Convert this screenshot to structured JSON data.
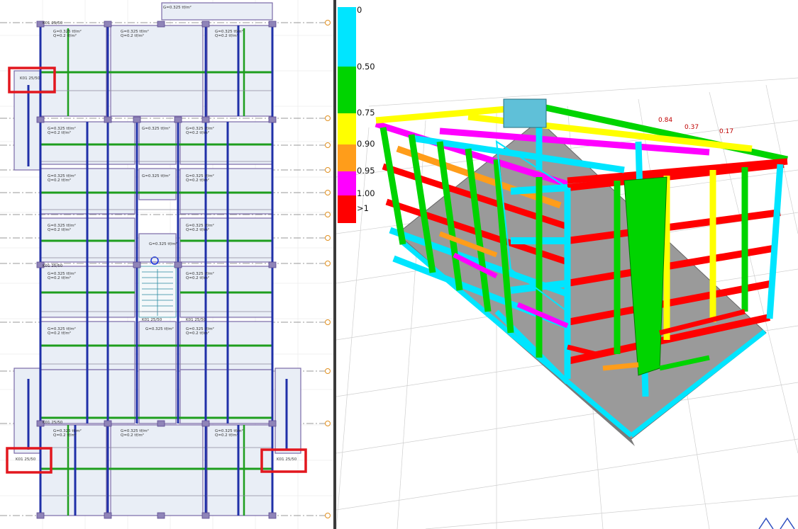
{
  "plan": {
    "load_text_g": "G=0.325 tf/m²",
    "load_text_q": "Q=0.2 tf/m²",
    "beam_label": "K01 25/50",
    "top_beam_label": "K01 25/50"
  },
  "legend": {
    "labels": [
      "0",
      "0.50",
      "0.75",
      "0.90",
      "0.95",
      "1.00",
      ">1"
    ],
    "colors": {
      "cyan": "#00e5ff",
      "green": "#00d400",
      "yellow": "#ffff00",
      "orange": "#ff9d1a",
      "magenta": "#ff00ff",
      "red": "#ff0000"
    }
  },
  "view3d": {
    "beam_values": [
      "0.84",
      "0.37",
      "0.17"
    ]
  },
  "toolbar": {
    "nav_icon": "orbit-navigation-icon"
  },
  "highlight_color": "#e2171e"
}
